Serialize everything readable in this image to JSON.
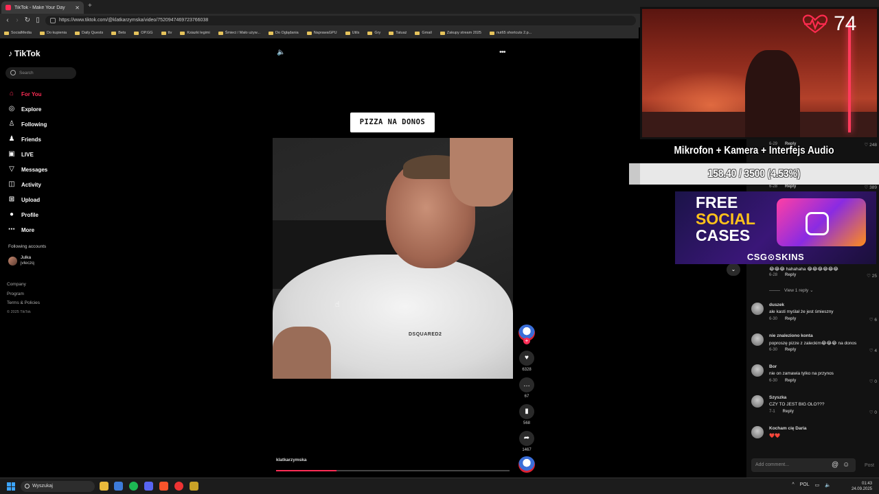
{
  "browser": {
    "tab_title": "TikTok - Make Your Day",
    "url": "https://www.tiktok.com/@klatkarzymska/video/7520947469723766038",
    "bookmarks": [
      "SocialMedia",
      "Do kupienia",
      "Daily Quests",
      "Bets",
      "OP.GG",
      "ttv",
      "Ksiazki legimi",
      "Śmieci / Mało używ...",
      "Do Oglądania",
      "NaprawaGPU",
      "Utils",
      "Gry",
      "Tatuaż",
      "Gmail",
      "Zakupy stream 2025",
      "nut65 shortcuts 2.p..."
    ]
  },
  "sidebar": {
    "logo": "TikTok",
    "search_placeholder": "Search",
    "menu": [
      {
        "label": "For You",
        "icon": "home-icon"
      },
      {
        "label": "Explore",
        "icon": "compass-icon"
      },
      {
        "label": "Following",
        "icon": "following-icon"
      },
      {
        "label": "Friends",
        "icon": "friends-icon"
      },
      {
        "label": "LIVE",
        "icon": "live-icon"
      },
      {
        "label": "Messages",
        "icon": "messages-icon"
      },
      {
        "label": "Activity",
        "icon": "activity-icon"
      },
      {
        "label": "Upload",
        "icon": "upload-icon"
      },
      {
        "label": "Profile",
        "icon": "profile-icon"
      },
      {
        "label": "More",
        "icon": "more-icon"
      }
    ],
    "following_title": "Following accounts",
    "following_account": {
      "name": "Julka",
      "handle": "jvleczq"
    },
    "footer_links": [
      "Company",
      "Program",
      "Terms & Policies"
    ],
    "copyright": "© 2025 TikTok"
  },
  "video": {
    "caption": "PIZZA NA DONOS",
    "shirt_text": "DSQUARED2",
    "username": "klatkarzymska",
    "progress": 0.26,
    "likes": "6328",
    "comments": "67",
    "saves": "568",
    "shares": "1467"
  },
  "comments": [
    {
      "meta_date": "6-29",
      "likes": "248"
    },
    {
      "meta_date": "6-28",
      "likes": "389"
    },
    {
      "text": "😂😂😂 hahahaha 😂😂😂😂😂😂",
      "meta_date": "6-28",
      "likes": "25"
    },
    {
      "name": "duszek",
      "text": "ale kasti myślał że jest śmieszny",
      "meta_date": "6-30",
      "likes": "6"
    },
    {
      "name": "nie znaleziono konta",
      "text": "poproszę pizze z zaleckim😂😂😂 na donos",
      "meta_date": "6-30",
      "likes": "4"
    },
    {
      "name": "Bor",
      "text": "nie on zamawia tylko na przynos",
      "meta_date": "6-30",
      "likes": "0"
    },
    {
      "name": "Szyszka",
      "text": "CZY TO JEST BIG OLO???",
      "meta_date": "7-1",
      "likes": "0"
    },
    {
      "name": "Kocham cię Daria",
      "text": "❤️❤️"
    }
  ],
  "reply_label": "Reply",
  "view_reply": "View 1 reply",
  "add_comment_placeholder": "Add comment...",
  "post_label": "Post",
  "overlay": {
    "heart_rate": "74",
    "goal_title": "Mikrofon + Kamera + Interfejs Audio",
    "goal_progress_text": "158.40 / 3500 (4.53%)",
    "goal_fraction": 0.0453,
    "ad_line1": "FREE",
    "ad_line2": "SOCIAL",
    "ad_line3": "CASES",
    "ad_brand": "CSG⊙SKINS"
  },
  "taskbar": {
    "search_placeholder": "Wyszukaj",
    "lang": "POL",
    "time": "01:43",
    "date": "24.09.2025"
  },
  "colors": {
    "accent": "#fe2c55",
    "goal_bg": "#e8e8e8"
  }
}
